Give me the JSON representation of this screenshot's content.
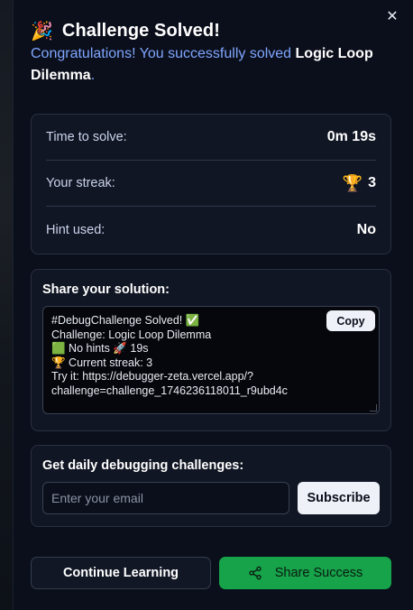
{
  "modal": {
    "close_glyph": "✕",
    "title_icon": "🎉",
    "title": "Challenge Solved!",
    "subtitle_prefix": "Congratulations! You successfully solved ",
    "challenge_name": "Logic Loop Dilemma",
    "subtitle_suffix": "."
  },
  "stats": [
    {
      "label": "Time to solve:",
      "value": "0m 19s"
    },
    {
      "label": "Your streak:",
      "value": "3",
      "icon": "🏆"
    },
    {
      "label": "Hint used:",
      "value": "No"
    }
  ],
  "share": {
    "heading": "Share your solution:",
    "text": "#DebugChallenge Solved! ✅\nChallenge: Logic Loop Dilemma\n🟩 No hints 🚀 19s\n🏆 Current streak: 3\nTry it: https://debugger-zeta.vercel.app/?\nchallenge=challenge_1746236118011_r9ubd4c",
    "copy_label": "Copy"
  },
  "subscribe": {
    "heading": "Get daily debugging challenges:",
    "email_placeholder": "Enter your email",
    "email_value": "",
    "button_label": "Subscribe"
  },
  "actions": {
    "continue_label": "Continue Learning",
    "share_success_label": "Share Success",
    "share_success_icon": "share-nodes-icon"
  },
  "colors": {
    "background": "#0b0f1b",
    "card": "#111624",
    "accent_blue": "#7fa6ff",
    "success_green": "#16a34a"
  }
}
